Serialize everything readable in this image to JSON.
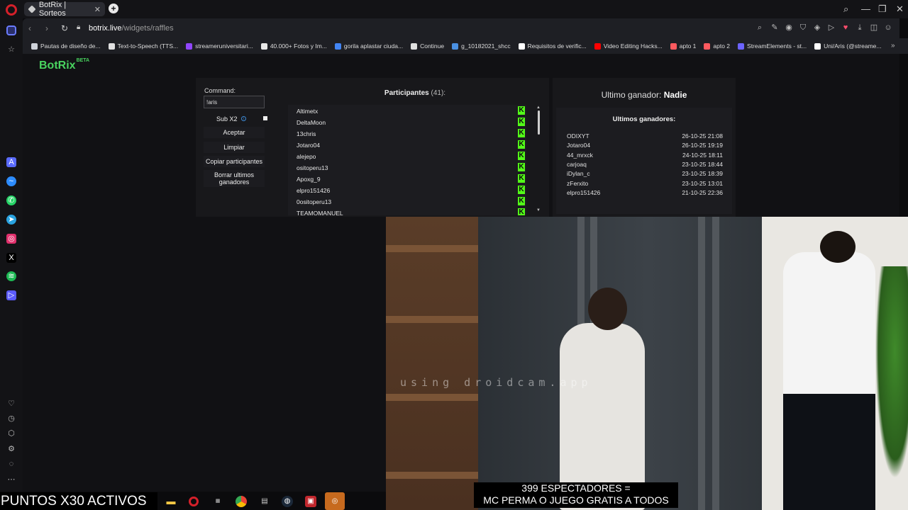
{
  "browser": {
    "tab_title": "BotRix | Sorteos",
    "tab_close": "✕",
    "new_tab": "+",
    "url_host": "botrix.live",
    "url_path": "/widgets/raffles",
    "window_controls": {
      "search": "⌕",
      "minimize": "—",
      "restore": "❐",
      "close": "✕"
    }
  },
  "bookmarks": [
    {
      "label": "Pautas de diseño de...",
      "color": "#cfd3da"
    },
    {
      "label": "Text-to-Speech (TTS...",
      "color": "#e0e0e0"
    },
    {
      "label": "streameruniversitari...",
      "color": "#9146ff"
    },
    {
      "label": "40.000+ Fotos y Im...",
      "color": "#e8e8e8"
    },
    {
      "label": "gorila aplastar ciuda...",
      "color": "#4285f4"
    },
    {
      "label": "Continue",
      "color": "#e0e0e0"
    },
    {
      "label": "g_10182021_shcc",
      "color": "#4a90e2"
    },
    {
      "label": "Requisitos de verific...",
      "color": "#ffffff"
    },
    {
      "label": "Video Editing Hacks...",
      "color": "#ff0000"
    },
    {
      "label": "apto 1",
      "color": "#ff5a5f"
    },
    {
      "label": "apto 2",
      "color": "#ff5a5f"
    },
    {
      "label": "StreamElements - st...",
      "color": "#6c63ff"
    },
    {
      "label": "Uni/Aris (@streame...",
      "color": "#ffffff"
    }
  ],
  "app": {
    "logo": "BotRix",
    "logo_badge": "BETA",
    "command_label": "Command:",
    "command_value": "!aris",
    "sub_label": "Sub X2",
    "sub_info_icon": "i",
    "buttons": {
      "accept": "Aceptar",
      "clear": "Limpiar",
      "copy": "Copiar participantes",
      "delete_line1": "Borrar ultimos",
      "delete_line2": "ganadores"
    },
    "participants_title": "Participantes",
    "participants_count": "(41):",
    "participants": [
      "Altimetx",
      "DeltaMoon",
      "13chris",
      "Jotaro04",
      "alejepo",
      "ositoperu13",
      "Apoxg_9",
      "elpro151426",
      "0ositoperu13",
      "TEAMOMANUEL"
    ],
    "platform_badge": "K",
    "last_winner_label": "Ultimo ganador:",
    "last_winner_value": "Nadie",
    "winners_title": "Ultimos ganadores:",
    "winners": [
      {
        "name": "ODIXYT",
        "date": "26-10-25 21:08"
      },
      {
        "name": "Jotaro04",
        "date": "26-10-25 19:19"
      },
      {
        "name": "44_mrxck",
        "date": "24-10-25 18:11"
      },
      {
        "name": "carjoaq",
        "date": "23-10-25 18:44"
      },
      {
        "name": "iDylan_c",
        "date": "23-10-25 18:39"
      },
      {
        "name": "zFerxito",
        "date": "23-10-25 13:01"
      },
      {
        "name": "elpro151426",
        "date": "21-10-25 22:36"
      }
    ]
  },
  "stream": {
    "watermark": "using droidcam.app",
    "caption_line1": "399 ESPECTADORES =",
    "caption_line2": "MC PERMA O JUEGO GRATIS A TODOS",
    "ticker": "PUNTOS X30 ACTIVOS"
  },
  "colors": {
    "brand": "#49d35f",
    "kick": "#53fc18",
    "opera": "#d4202a"
  }
}
